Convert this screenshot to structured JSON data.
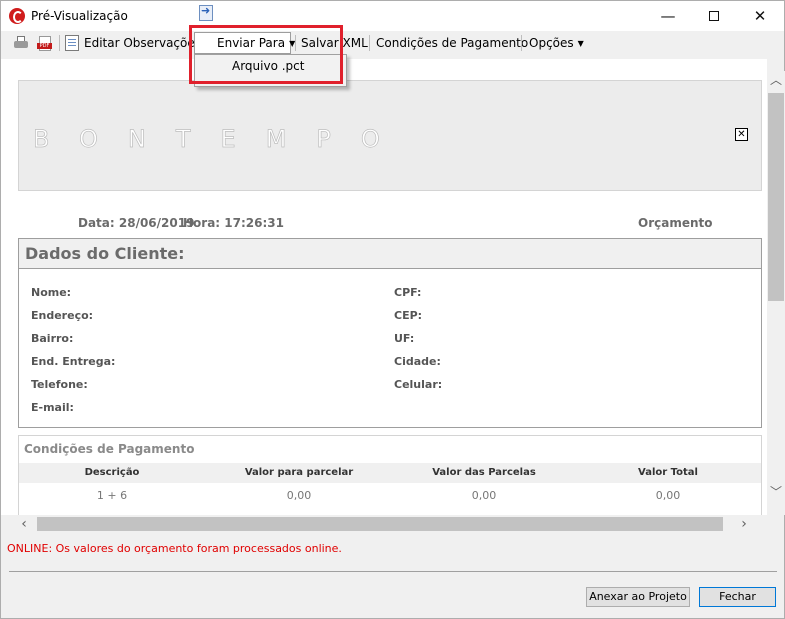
{
  "window": {
    "title": "Pré-Visualização"
  },
  "toolbar": {
    "editar": "Editar Observações",
    "enviar": "Enviar Para",
    "salvar": "Salvar XML",
    "condicoes": "Condições de Pagamento",
    "opcoes": "Opções",
    "pdf_tag": "PDF"
  },
  "dropdown": {
    "items": [
      "Arquivo .pct"
    ]
  },
  "document": {
    "logo_text": "BONTEMPO",
    "data_label": "Data: 28/06/2019",
    "hora_label": "Hora: 17:26:31",
    "tipo": "Orçamento",
    "cliente": {
      "header": "Dados do Cliente:",
      "left": [
        "Nome:",
        "Endereço:",
        "Bairro:",
        "End. Entrega:",
        "Telefone:",
        "E-mail:"
      ],
      "right": [
        "CPF:",
        "CEP:",
        "UF:",
        "Cidade:",
        "Celular:"
      ]
    },
    "pagamento": {
      "title": "Condições de Pagamento",
      "columns": [
        "Descrição",
        "Valor para parcelar",
        "Valor das Parcelas",
        "Valor Total"
      ],
      "rows": [
        [
          "1 + 6",
          "0,00",
          "0,00",
          "0,00"
        ]
      ]
    }
  },
  "status": "ONLINE: Os valores do orçamento foram processados online.",
  "buttons": {
    "anexar": "Anexar ao Projeto",
    "fechar": "Fechar"
  }
}
